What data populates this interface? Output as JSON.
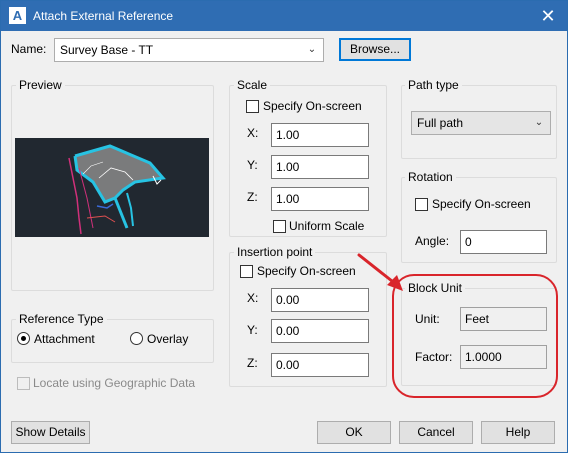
{
  "window": {
    "title": "Attach External Reference",
    "app_icon": "A",
    "close_glyph": "✕"
  },
  "name": {
    "label": "Name:",
    "value": "Survey Base - TT",
    "browse_label": "Browse..."
  },
  "preview": {
    "title": "Preview"
  },
  "reference_type": {
    "title": "Reference Type",
    "attachment": "Attachment",
    "overlay": "Overlay",
    "selected": "Attachment"
  },
  "geo": {
    "label": "Locate using Geographic Data"
  },
  "scale": {
    "title": "Scale",
    "specify": "Specify On-screen",
    "x_label": "X:",
    "x": "1.00",
    "y_label": "Y:",
    "y": "1.00",
    "z_label": "Z:",
    "z": "1.00",
    "uniform": "Uniform Scale"
  },
  "insertion": {
    "title": "Insertion point",
    "specify": "Specify On-screen",
    "x_label": "X:",
    "x": "0.00",
    "y_label": "Y:",
    "y": "0.00",
    "z_label": "Z:",
    "z": "0.00"
  },
  "path_type": {
    "title": "Path type",
    "value": "Full path"
  },
  "rotation": {
    "title": "Rotation",
    "specify": "Specify On-screen",
    "angle_label": "Angle:",
    "angle": "0"
  },
  "block_unit": {
    "title": "Block Unit",
    "unit_label": "Unit:",
    "unit": "Feet",
    "factor_label": "Factor:",
    "factor": "1.0000"
  },
  "buttons": {
    "show_details": "Show Details",
    "ok": "OK",
    "cancel": "Cancel",
    "help": "Help"
  },
  "annotation_color": "#d9252b"
}
